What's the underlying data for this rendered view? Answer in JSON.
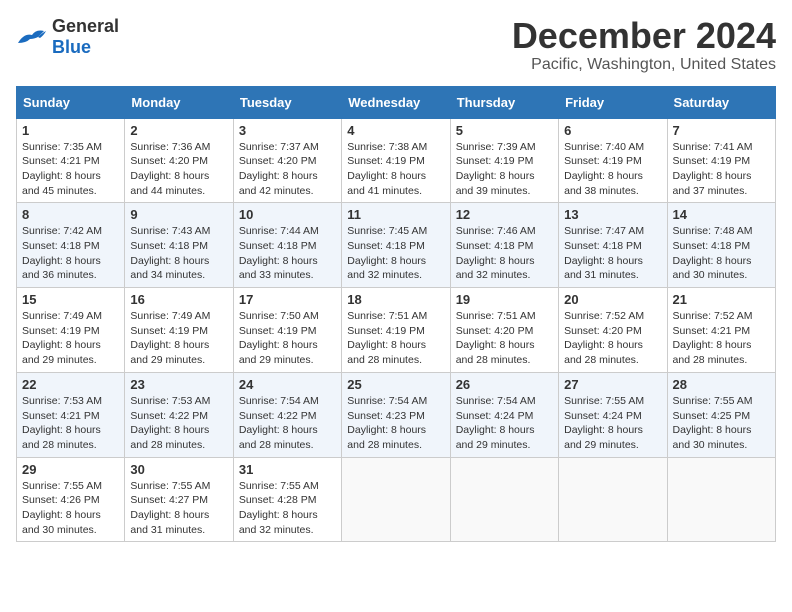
{
  "logo": {
    "general": "General",
    "blue": "Blue"
  },
  "title": {
    "month_year": "December 2024",
    "location": "Pacific, Washington, United States"
  },
  "weekdays": [
    "Sunday",
    "Monday",
    "Tuesday",
    "Wednesday",
    "Thursday",
    "Friday",
    "Saturday"
  ],
  "weeks": [
    [
      {
        "day": "1",
        "sunrise": "7:35 AM",
        "sunset": "4:21 PM",
        "daylight": "8 hours and 45 minutes."
      },
      {
        "day": "2",
        "sunrise": "7:36 AM",
        "sunset": "4:20 PM",
        "daylight": "8 hours and 44 minutes."
      },
      {
        "day": "3",
        "sunrise": "7:37 AM",
        "sunset": "4:20 PM",
        "daylight": "8 hours and 42 minutes."
      },
      {
        "day": "4",
        "sunrise": "7:38 AM",
        "sunset": "4:19 PM",
        "daylight": "8 hours and 41 minutes."
      },
      {
        "day": "5",
        "sunrise": "7:39 AM",
        "sunset": "4:19 PM",
        "daylight": "8 hours and 39 minutes."
      },
      {
        "day": "6",
        "sunrise": "7:40 AM",
        "sunset": "4:19 PM",
        "daylight": "8 hours and 38 minutes."
      },
      {
        "day": "7",
        "sunrise": "7:41 AM",
        "sunset": "4:19 PM",
        "daylight": "8 hours and 37 minutes."
      }
    ],
    [
      {
        "day": "8",
        "sunrise": "7:42 AM",
        "sunset": "4:18 PM",
        "daylight": "8 hours and 36 minutes."
      },
      {
        "day": "9",
        "sunrise": "7:43 AM",
        "sunset": "4:18 PM",
        "daylight": "8 hours and 34 minutes."
      },
      {
        "day": "10",
        "sunrise": "7:44 AM",
        "sunset": "4:18 PM",
        "daylight": "8 hours and 33 minutes."
      },
      {
        "day": "11",
        "sunrise": "7:45 AM",
        "sunset": "4:18 PM",
        "daylight": "8 hours and 32 minutes."
      },
      {
        "day": "12",
        "sunrise": "7:46 AM",
        "sunset": "4:18 PM",
        "daylight": "8 hours and 32 minutes."
      },
      {
        "day": "13",
        "sunrise": "7:47 AM",
        "sunset": "4:18 PM",
        "daylight": "8 hours and 31 minutes."
      },
      {
        "day": "14",
        "sunrise": "7:48 AM",
        "sunset": "4:18 PM",
        "daylight": "8 hours and 30 minutes."
      }
    ],
    [
      {
        "day": "15",
        "sunrise": "7:49 AM",
        "sunset": "4:19 PM",
        "daylight": "8 hours and 29 minutes."
      },
      {
        "day": "16",
        "sunrise": "7:49 AM",
        "sunset": "4:19 PM",
        "daylight": "8 hours and 29 minutes."
      },
      {
        "day": "17",
        "sunrise": "7:50 AM",
        "sunset": "4:19 PM",
        "daylight": "8 hours and 29 minutes."
      },
      {
        "day": "18",
        "sunrise": "7:51 AM",
        "sunset": "4:19 PM",
        "daylight": "8 hours and 28 minutes."
      },
      {
        "day": "19",
        "sunrise": "7:51 AM",
        "sunset": "4:20 PM",
        "daylight": "8 hours and 28 minutes."
      },
      {
        "day": "20",
        "sunrise": "7:52 AM",
        "sunset": "4:20 PM",
        "daylight": "8 hours and 28 minutes."
      },
      {
        "day": "21",
        "sunrise": "7:52 AM",
        "sunset": "4:21 PM",
        "daylight": "8 hours and 28 minutes."
      }
    ],
    [
      {
        "day": "22",
        "sunrise": "7:53 AM",
        "sunset": "4:21 PM",
        "daylight": "8 hours and 28 minutes."
      },
      {
        "day": "23",
        "sunrise": "7:53 AM",
        "sunset": "4:22 PM",
        "daylight": "8 hours and 28 minutes."
      },
      {
        "day": "24",
        "sunrise": "7:54 AM",
        "sunset": "4:22 PM",
        "daylight": "8 hours and 28 minutes."
      },
      {
        "day": "25",
        "sunrise": "7:54 AM",
        "sunset": "4:23 PM",
        "daylight": "8 hours and 28 minutes."
      },
      {
        "day": "26",
        "sunrise": "7:54 AM",
        "sunset": "4:24 PM",
        "daylight": "8 hours and 29 minutes."
      },
      {
        "day": "27",
        "sunrise": "7:55 AM",
        "sunset": "4:24 PM",
        "daylight": "8 hours and 29 minutes."
      },
      {
        "day": "28",
        "sunrise": "7:55 AM",
        "sunset": "4:25 PM",
        "daylight": "8 hours and 30 minutes."
      }
    ],
    [
      {
        "day": "29",
        "sunrise": "7:55 AM",
        "sunset": "4:26 PM",
        "daylight": "8 hours and 30 minutes."
      },
      {
        "day": "30",
        "sunrise": "7:55 AM",
        "sunset": "4:27 PM",
        "daylight": "8 hours and 31 minutes."
      },
      {
        "day": "31",
        "sunrise": "7:55 AM",
        "sunset": "4:28 PM",
        "daylight": "8 hours and 32 minutes."
      },
      null,
      null,
      null,
      null
    ]
  ],
  "labels": {
    "sunrise": "Sunrise:",
    "sunset": "Sunset:",
    "daylight": "Daylight:"
  }
}
